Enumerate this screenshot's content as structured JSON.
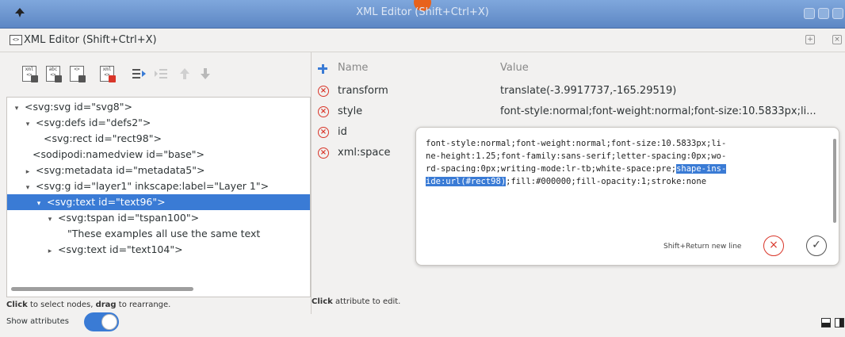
{
  "window": {
    "title": "XML Editor (Shift+Ctrl+X)"
  },
  "dock": {
    "title": "XML Editor (Shift+Ctrl+X)"
  },
  "toolbar": {
    "buttons": [
      {
        "name": "new-element-node",
        "icon": "xml"
      },
      {
        "name": "new-text-node",
        "icon": "abc"
      },
      {
        "name": "duplicate-node",
        "icon": "copy"
      },
      {
        "name": "delete-node",
        "icon": "xml"
      },
      {
        "name": "unindent-node",
        "icon": "unindent"
      },
      {
        "name": "indent-node",
        "icon": "indent"
      },
      {
        "name": "raise-node",
        "icon": "arrow-up"
      },
      {
        "name": "lower-node",
        "icon": "arrow-down"
      }
    ]
  },
  "tree": {
    "nodes": [
      {
        "text": "<svg:svg id=\"svg8\">",
        "expander": "▾"
      },
      {
        "text": "<svg:defs id=\"defs2\">",
        "expander": "▾"
      },
      {
        "text": "<svg:rect id=\"rect98\">",
        "expander": ""
      },
      {
        "text": "<sodipodi:namedview id=\"base\">",
        "expander": ""
      },
      {
        "text": "<svg:metadata id=\"metadata5\">",
        "expander": "▸"
      },
      {
        "text": "<svg:g id=\"layer1\" inkscape:label=\"Layer 1\">",
        "expander": "▾"
      },
      {
        "text": "<svg:text id=\"text96\">",
        "expander": "▾"
      },
      {
        "text": "<svg:tspan id=\"tspan100\">",
        "expander": "▾"
      },
      {
        "text": "\"These examples all use the same text",
        "expander": ""
      },
      {
        "text": "<svg:text id=\"text104\">",
        "expander": "▸"
      }
    ],
    "selected_index": 6
  },
  "left_status": {
    "bold1": "Click",
    "mid": " to select nodes, ",
    "bold2": "drag",
    "end": " to rearrange."
  },
  "show_attributes": {
    "label": "Show attributes",
    "on": true
  },
  "attributes": {
    "header_name": "Name",
    "header_value": "Value",
    "rows": [
      {
        "name": "transform",
        "value": "translate(-3.9917737,-165.29519)"
      },
      {
        "name": "style",
        "value": "font-style:normal;font-weight:normal;font-size:10.5833px;li..."
      },
      {
        "name": "id",
        "value": ""
      },
      {
        "name": "xml:space",
        "value": ""
      }
    ]
  },
  "editor": {
    "text_before": "font-style:normal;font-weight:normal;font-size:10.5833px;li-\nne-height:1.25;font-family:sans-serif;letter-spacing:0px;wo-\nrd-spacing:0px;writing-mode:lr-tb;white-space:pre;",
    "text_highlight1": "shape-ins-",
    "text_highlight2": "ide:url(#rect98)",
    "text_after": ";fill:#000000;fill-opacity:1;stroke:none",
    "hint": "Shift+Return new line"
  },
  "right_status": {
    "bold": "Click",
    "rest": " attribute to edit."
  },
  "colors": {
    "titlebar": "#6f98d2",
    "selection": "#3a7bd5",
    "delete": "#d9362a"
  }
}
